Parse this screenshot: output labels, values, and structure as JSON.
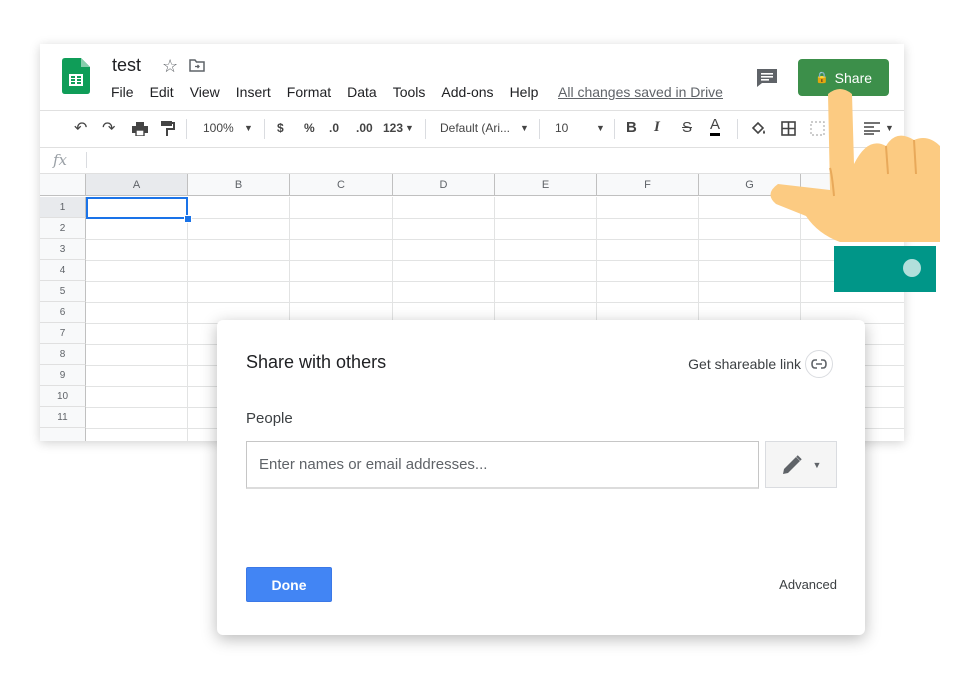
{
  "app": {
    "doc_title": "test",
    "menu": [
      "File",
      "Edit",
      "View",
      "Insert",
      "Format",
      "Data",
      "Tools",
      "Add-ons",
      "Help"
    ],
    "save_status": "All changes saved in Drive",
    "share_label": "Share"
  },
  "toolbar": {
    "zoom": "100%",
    "currency": "$",
    "percent": "%",
    "decrease_decimals": ".0",
    "increase_decimals": ".00",
    "more_formats": "123",
    "font": "Default (Ari...",
    "font_size": "10",
    "bold": "B",
    "italic": "I",
    "strikethrough": "S",
    "text_color": "A"
  },
  "formula_bar": {
    "fx": "fx"
  },
  "grid": {
    "columns": [
      "A",
      "B",
      "C",
      "D",
      "E",
      "F",
      "G"
    ],
    "rows": [
      "1",
      "2",
      "3",
      "4",
      "5",
      "6",
      "7",
      "8",
      "9",
      "10",
      "11"
    ],
    "selected_cell": "A1"
  },
  "dialog": {
    "title": "Share with others",
    "shareable_link_label": "Get shareable link",
    "people_label": "People",
    "email_placeholder": "Enter names or email addresses...",
    "done_label": "Done",
    "advanced_label": "Advanced"
  },
  "colors": {
    "share_green": "#3c8f4a",
    "done_blue": "#4285f4",
    "selection_blue": "#1a73e8",
    "sheets_logo_green": "#0f9d58",
    "cuff_teal": "#009688",
    "skin": "#fccb82"
  }
}
